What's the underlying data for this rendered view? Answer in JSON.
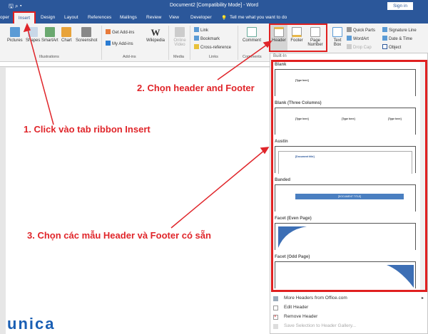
{
  "titlebar": {
    "title": "Document2 [Compatibility Mode] - Word",
    "sign_in": "Sign in"
  },
  "tabs": [
    "oper",
    "Insert",
    "Design",
    "Layout",
    "References",
    "Mailings",
    "Review",
    "View",
    "Developer"
  ],
  "tell_me": "Tell me what you want to do",
  "ribbon": {
    "illustrations": [
      "Pictures",
      "Shapes",
      "SmartArt",
      "Chart",
      "Screenshot"
    ],
    "illustrations_label": "Illustrations",
    "addins": [
      "Get Add-ins",
      "My Add-ins",
      "Wikipedia"
    ],
    "addins_label": "Add-ins",
    "media": "Online Video",
    "media_label": "Media",
    "links": [
      "Link",
      "Bookmark",
      "Cross-reference"
    ],
    "links_label": "Links",
    "comment": "Comment",
    "comments_label": "Comments",
    "header": "Header",
    "footer": "Footer",
    "page_number": "Page Number",
    "text_box": "Text Box",
    "text_small": [
      "Quick Parts",
      "WordArt",
      "Drop Cap",
      "Signature Line",
      "Date & Time",
      "Object"
    ]
  },
  "dropdown": {
    "section": "Built-In",
    "gallery": [
      {
        "name": "Blank",
        "texts": [
          "[Type here]"
        ]
      },
      {
        "name": "Blank (Three Columns)",
        "texts": [
          "[Type here]",
          "[Type here]",
          "[Type here]"
        ]
      },
      {
        "name": "Austin",
        "texts": [
          "[Document title]"
        ]
      },
      {
        "name": "Banded",
        "texts": [
          "[DOCUMENT TITLE]"
        ]
      },
      {
        "name": "Facet (Even Page)",
        "texts": []
      },
      {
        "name": "Facet (Odd Page)",
        "texts": []
      }
    ],
    "menu": [
      "More Headers from Office.com",
      "Edit Header",
      "Remove Header",
      "Save Selection to Header Gallery..."
    ]
  },
  "annotations": {
    "step1": "1. Click vào tab ribbon Insert",
    "step2": "2. Chọn header and Footer",
    "step3": "3. Chọn các mẫu Header và Footer có sẵn",
    "color": "#e0252a"
  },
  "logo": "unica",
  "colors": {
    "word_blue": "#2b579a",
    "highlight_red": "#e02020"
  }
}
